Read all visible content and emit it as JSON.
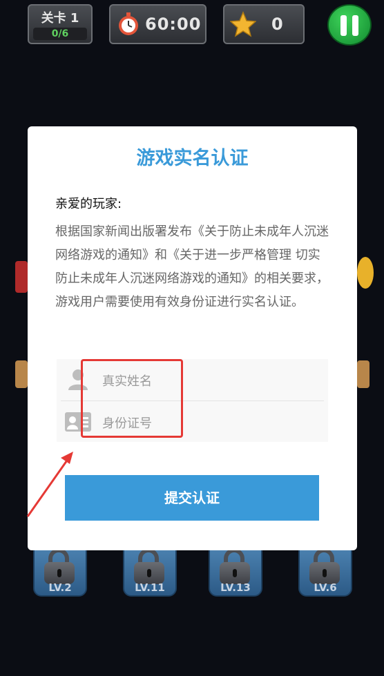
{
  "hud": {
    "level_label": "关卡 1",
    "progress": "0/6",
    "timer": "60:00",
    "stars": "0"
  },
  "locks": [
    "LV.2",
    "LV.11",
    "LV.13",
    "LV.6"
  ],
  "modal": {
    "title": "游戏实名认证",
    "greeting": "亲爱的玩家:",
    "notice": "根据国家新闻出版署发布《关于防止未成年人沉迷网络游戏的通知》和《关于进一步严格管理 切实防止未成年人沉迷网络游戏的通知》的相关要求，游戏用户需要使用有效身份证进行实名认证。",
    "name_placeholder": "真实姓名",
    "id_placeholder": "身份证号",
    "submit_label": "提交认证"
  },
  "colors": {
    "accent": "#3a9ad9",
    "annotation": "#e53935"
  }
}
